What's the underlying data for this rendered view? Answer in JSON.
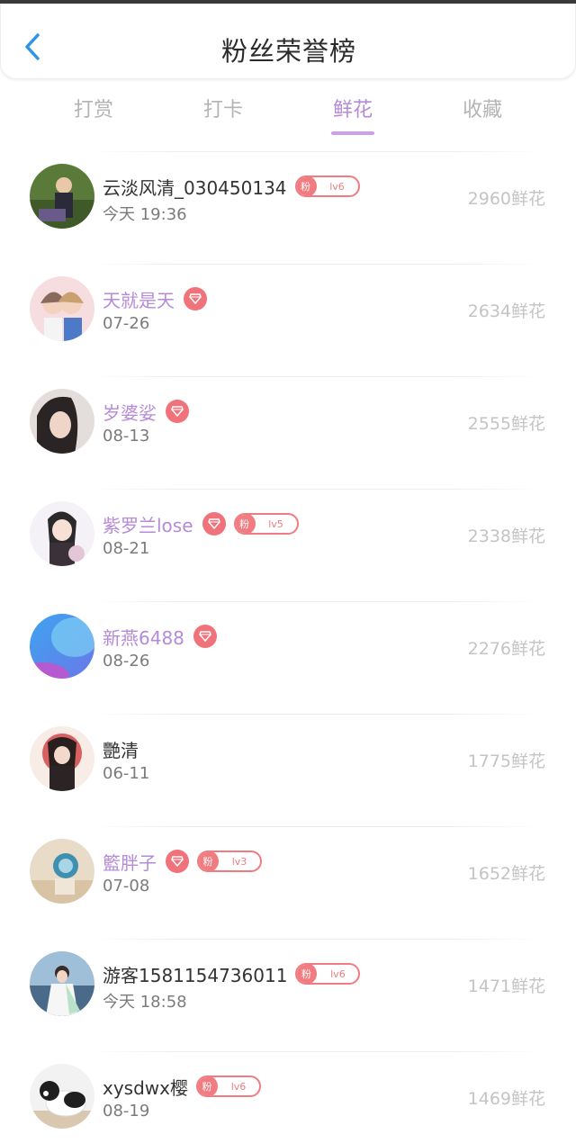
{
  "header": {
    "title": "粉丝荣誉榜",
    "back_icon": "chevron-left-icon",
    "accent": "#2f93e6"
  },
  "tabs": [
    {
      "label": "打赏",
      "active": false
    },
    {
      "label": "打卡",
      "active": false
    },
    {
      "label": "鲜花",
      "active": true
    },
    {
      "label": "收藏",
      "active": false
    }
  ],
  "colors": {
    "vip_name": "#b58ad8",
    "badge": "#f07b80",
    "count": "#c4c4c4"
  },
  "rows": [
    {
      "name": "云淡风清_030450134",
      "vip": false,
      "diamond": false,
      "fan_badge": {
        "label": "粉",
        "level": "lv6"
      },
      "time": "今天 19:36",
      "count": "2960鲜花"
    },
    {
      "name": "天就是天",
      "vip": true,
      "diamond": true,
      "fan_badge": null,
      "time": "07-26",
      "count": "2634鲜花"
    },
    {
      "name": "岁婆娑",
      "vip": true,
      "diamond": true,
      "fan_badge": null,
      "time": "08-13",
      "count": "2555鲜花"
    },
    {
      "name": "紫罗兰lose",
      "vip": true,
      "diamond": true,
      "fan_badge": {
        "label": "粉",
        "level": "lv5"
      },
      "time": "08-21",
      "count": "2338鲜花"
    },
    {
      "name": "新燕6488",
      "vip": true,
      "diamond": true,
      "fan_badge": null,
      "time": "08-26",
      "count": "2276鲜花"
    },
    {
      "name": "艷清",
      "vip": false,
      "diamond": false,
      "fan_badge": null,
      "time": "06-11",
      "count": "1775鲜花"
    },
    {
      "name": "籃胖子",
      "vip": true,
      "diamond": true,
      "fan_badge": {
        "label": "粉",
        "level": "lv3"
      },
      "time": "07-08",
      "count": "1652鲜花"
    },
    {
      "name": "游客1581154736011",
      "vip": false,
      "diamond": false,
      "fan_badge": {
        "label": "粉",
        "level": "lv6"
      },
      "time": "今天 18:58",
      "count": "1471鲜花"
    },
    {
      "name": "xysdwx樱",
      "vip": false,
      "diamond": false,
      "fan_badge": {
        "label": "粉",
        "level": "lv6"
      },
      "time": "08-19",
      "count": "1469鲜花"
    }
  ]
}
